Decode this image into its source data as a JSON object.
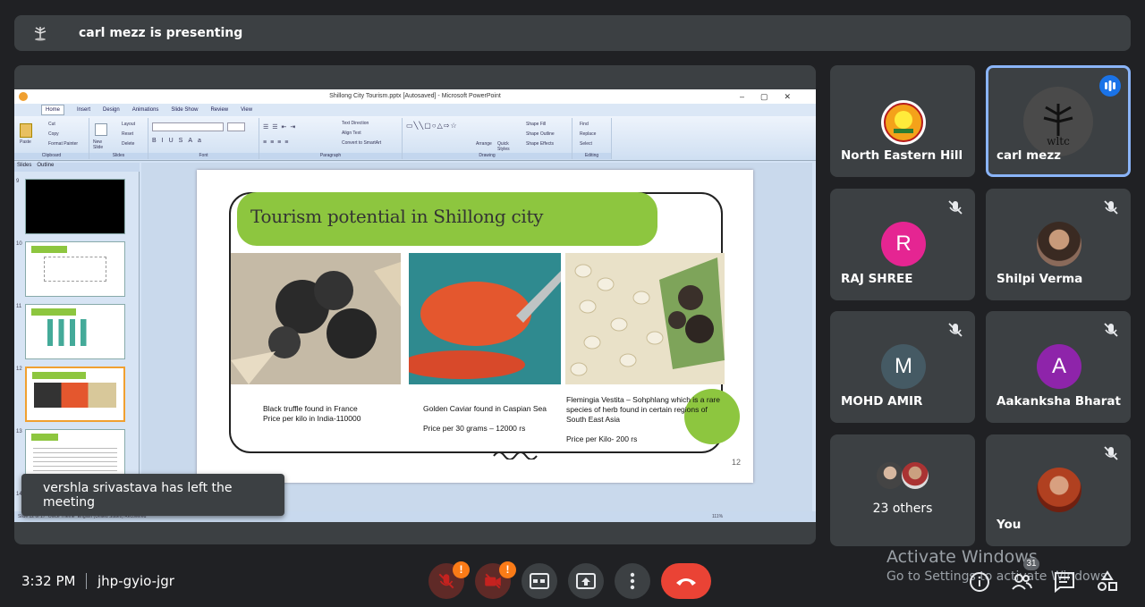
{
  "presenting": {
    "title": "carl mezz is presenting"
  },
  "powerpoint": {
    "window_title": "Shillong City Tourism.pptx [Autosaved] - Microsoft PowerPoint",
    "tabs": [
      "Home",
      "Insert",
      "Design",
      "Animations",
      "Slide Show",
      "Review",
      "View"
    ],
    "groups": [
      "Clipboard",
      "Slides",
      "Font",
      "Paragraph",
      "Drawing",
      "Editing"
    ],
    "clipboard_items": [
      "Paste",
      "Cut",
      "Copy",
      "Format Painter"
    ],
    "slides_items": [
      "New Slide",
      "Layout",
      "Reset",
      "Delete"
    ],
    "paragraph_items": [
      "Text Direction",
      "Align Text",
      "Convert to SmartArt"
    ],
    "drawing_items": [
      "Arrange",
      "Quick Styles",
      "Shape Fill",
      "Shape Outline",
      "Shape Effects"
    ],
    "editing_items": [
      "Find",
      "Replace",
      "Select"
    ],
    "panel_tabs": [
      "Slides",
      "Outline"
    ],
    "thumb_numbers": [
      "9",
      "10",
      "11",
      "12",
      "13",
      "14"
    ],
    "status_text": "Slide 12 of 17   \"Office Theme\"   English (United States)   Recovered",
    "zoom": "111%",
    "slide": {
      "heading": "Tourism potential in Shillong city",
      "captions": [
        "Black truffle found in France\n Price per kilo in India-110000",
        "Golden Caviar found in Caspian Sea\n\nPrice per 30 grams – 12000 rs",
        "Flemingia Vestita – Sohphlang which is a rare species of herb found in certain regions of South East Asia\n\nPrice per Kilo-  200 rs"
      ],
      "number": "12"
    }
  },
  "toast": "vershla srivastava has left the meeting",
  "participants": [
    {
      "name": "North Eastern Hill ...",
      "initial": "",
      "color": "#ffffff"
    },
    {
      "name": "carl mezz",
      "initial": "",
      "color": "#4a4a4a"
    },
    {
      "name": "RAJ SHREE",
      "initial": "R",
      "color": "#e52592"
    },
    {
      "name": "Shilpi Verma",
      "initial": "",
      "color": "#888888"
    },
    {
      "name": "MOHD AMIR",
      "initial": "M",
      "color": "#455a64"
    },
    {
      "name": "Aakanksha Bharati",
      "initial": "A",
      "color": "#8e24aa"
    },
    {
      "name": "23 others",
      "initial": "",
      "color": "#666666"
    },
    {
      "name": "You",
      "initial": "",
      "color": "#b04020"
    }
  ],
  "bottom": {
    "time": "3:32 PM",
    "meeting_code": "jhp-gyio-jgr",
    "people_count": "31",
    "warning_glyph": "!"
  },
  "watermark": {
    "line1": "Activate Windows",
    "line2": "Go to Settings to activate Windows."
  },
  "colors": {
    "bg": "#202124",
    "tile": "#3c4043",
    "accent": "#8ab4f8",
    "end_call": "#ea4335",
    "warning": "#fa7b17",
    "slide_green": "#8dc63f"
  }
}
